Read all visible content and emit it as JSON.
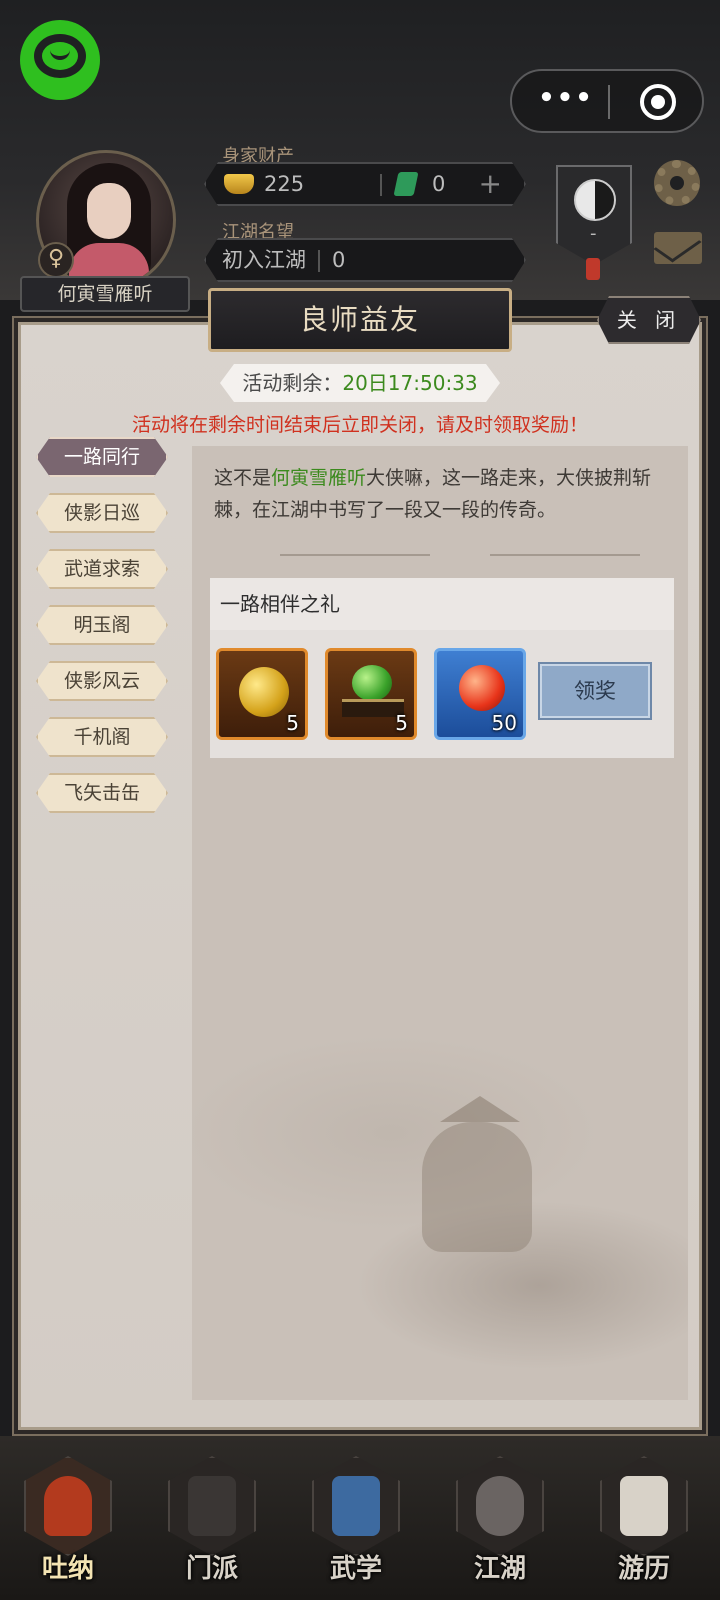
{
  "player": {
    "name": "何寅雪雁听",
    "gender_symbol": "♀"
  },
  "wealth": {
    "label": "身家财产",
    "gold": "225",
    "jade": "0"
  },
  "reputation": {
    "label": "江湖名望",
    "rank": "初入江湖",
    "value": "0"
  },
  "sect": {
    "value": "-"
  },
  "panel": {
    "title": "良师益友",
    "close_label": "关 闭",
    "timer_label": "活动剩余：",
    "timer_value": "20日17:50:33",
    "warning": "活动将在剩余时间结束后立即关闭，请及时领取奖励！"
  },
  "tabs": [
    {
      "label": "一路同行",
      "active": true
    },
    {
      "label": "侠影日巡",
      "active": false
    },
    {
      "label": "武道求索",
      "active": false
    },
    {
      "label": "明玉阁",
      "active": false
    },
    {
      "label": "侠影风云",
      "active": false
    },
    {
      "label": "千机阁",
      "active": false
    },
    {
      "label": "飞矢击缶",
      "active": false
    }
  ],
  "content": {
    "intro_prefix": "这不是",
    "intro_name": "何寅雪雁听",
    "intro_suffix": "大侠嘛，这一路走来，大侠披荆斩棘，在江湖中书写了一段又一段的传奇。",
    "reward_title": "一路相伴之礼",
    "items": [
      {
        "icon": "gold-orb-icon",
        "qty": "5",
        "frame": "orange"
      },
      {
        "icon": "green-jade-icon",
        "qty": "5",
        "frame": "orange"
      },
      {
        "icon": "red-orb-icon",
        "qty": "50",
        "frame": "blue"
      }
    ],
    "claim_label": "领奖"
  },
  "bottom_nav": [
    {
      "label": "吐纳",
      "active": true
    },
    {
      "label": "门派",
      "active": false
    },
    {
      "label": "武学",
      "active": false
    },
    {
      "label": "江湖",
      "active": false
    },
    {
      "label": "游历",
      "active": false
    }
  ],
  "colors": {
    "highlight_green": "#3c8a1e",
    "warning_red": "#d0311f",
    "active_tab": "#7a6670",
    "claim_button": "#8fa9c8"
  }
}
